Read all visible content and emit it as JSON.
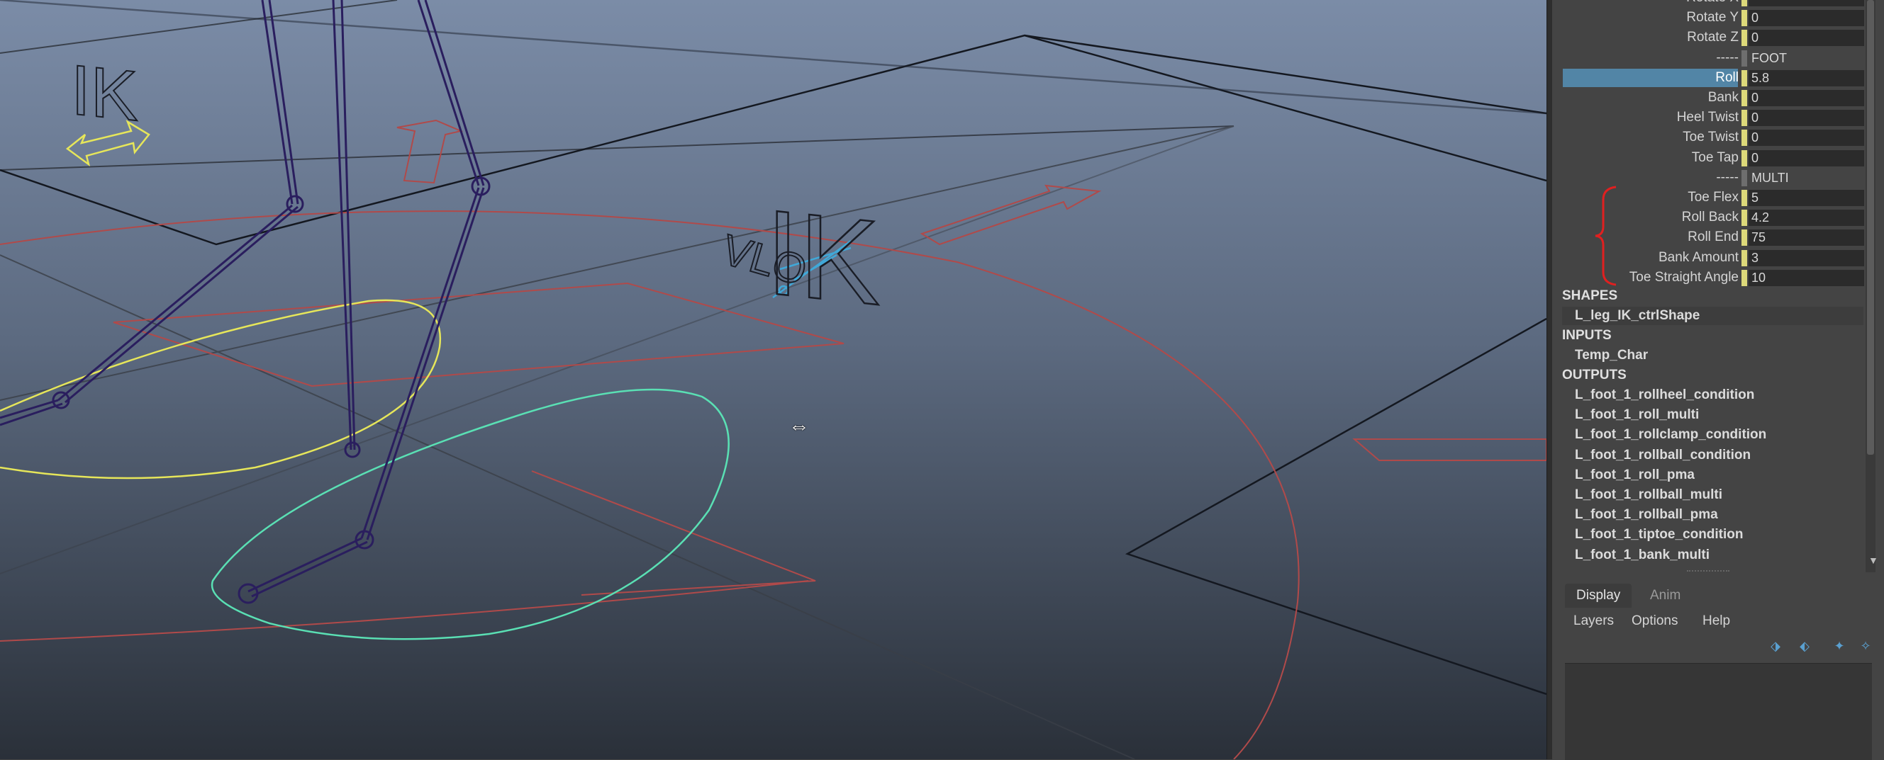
{
  "viewport": {
    "ik_label_main": "IK",
    "ik_label_left": "IK",
    "ctrl_text": "VLO"
  },
  "channel_box": {
    "attributes": [
      {
        "label": "Rotate X",
        "value": ""
      },
      {
        "label": "Rotate Y",
        "value": "0"
      },
      {
        "label": "Rotate Z",
        "value": "0"
      },
      {
        "label": "-----",
        "value": "FOOT",
        "separator": true
      },
      {
        "label": "Roll",
        "value": "5.8",
        "selected": true
      },
      {
        "label": "Bank",
        "value": "0"
      },
      {
        "label": "Heel Twist",
        "value": "0"
      },
      {
        "label": "Toe Twist",
        "value": "0"
      },
      {
        "label": "Toe Tap",
        "value": "0"
      },
      {
        "label": "-----",
        "value": "MULTI",
        "separator": true
      },
      {
        "label": "Toe Flex",
        "value": "5"
      },
      {
        "label": "Roll Back",
        "value": "4.2"
      },
      {
        "label": "Roll End",
        "value": "75"
      },
      {
        "label": "Bank Amount",
        "value": "3"
      },
      {
        "label": "Toe Straight Angle",
        "value": "10"
      }
    ],
    "shapes_header": "SHAPES",
    "shapes": [
      "L_leg_IK_ctrlShape"
    ],
    "inputs_header": "INPUTS",
    "inputs": [
      "Temp_Char"
    ],
    "outputs_header": "OUTPUTS",
    "outputs": [
      "L_foot_1_rollheel_condition",
      "L_foot_1_roll_multi",
      "L_foot_1_rollclamp_condition",
      "L_foot_1_rollball_condition",
      "L_foot_1_roll_pma",
      "L_foot_1_rollball_multi",
      "L_foot_1_rollball_pma",
      "L_foot_1_tiptoe_condition",
      "L_foot_1_bank_multi"
    ]
  },
  "layer_editor": {
    "tabs": [
      "Display",
      "Anim"
    ],
    "menus": [
      "Layers",
      "Options",
      "Help"
    ],
    "tool_icons": [
      "move-layer-up-icon",
      "move-layer-down-icon",
      "new-layer-icon",
      "new-layer-from-selected-icon"
    ]
  },
  "colors": {
    "viewport_top": "#7a8ba6",
    "viewport_bottom": "#2a3038",
    "joint_purple": "#2b1e5c",
    "ik_yellow": "#e8e85a",
    "foot_cyan": "#58e0b0",
    "red_guides": "#b04848",
    "selection_blue": "#5285a6",
    "annotation_red": "#e02020"
  }
}
